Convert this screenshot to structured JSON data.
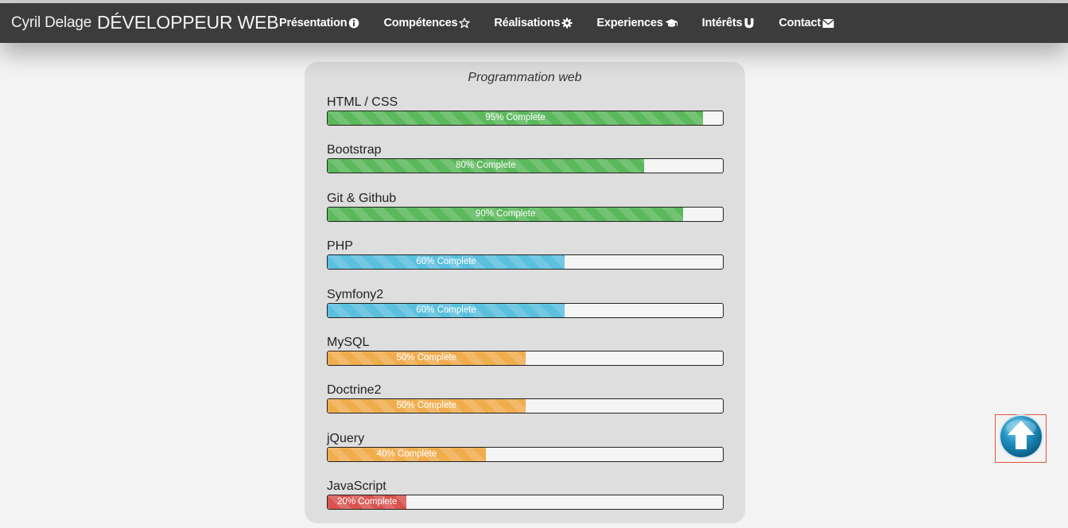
{
  "header": {
    "name": "Cyril Delage",
    "title": "DÉVELOPPEUR WEB",
    "nav": [
      {
        "label": "Présentation",
        "icon": "info-circle-icon"
      },
      {
        "label": "Compétences",
        "icon": "star-icon"
      },
      {
        "label": "Réalisations",
        "icon": "gear-icon"
      },
      {
        "label": "Experiences",
        "icon": "graduation-cap-icon"
      },
      {
        "label": "Intérêts",
        "icon": "magnet-icon"
      },
      {
        "label": "Contact",
        "icon": "envelope-icon"
      }
    ]
  },
  "panel": {
    "title": "Programmation web",
    "skills": [
      {
        "name": "HTML / CSS",
        "percent": 95,
        "label": "95% Complete",
        "color": "#5cb85c"
      },
      {
        "name": "Bootstrap",
        "percent": 80,
        "label": "80% Complete",
        "color": "#5cb85c"
      },
      {
        "name": "Git & Github",
        "percent": 90,
        "label": "90% Complete",
        "color": "#5cb85c"
      },
      {
        "name": "PHP",
        "percent": 60,
        "label": "60% Complete",
        "color": "#5bc0de"
      },
      {
        "name": "Symfony2",
        "percent": 60,
        "label": "60% Complete",
        "color": "#5bc0de"
      },
      {
        "name": "MySQL",
        "percent": 50,
        "label": "50% Complete",
        "color": "#f0ad4e"
      },
      {
        "name": "Doctrine2",
        "percent": 50,
        "label": "50% Complete",
        "color": "#f0ad4e"
      },
      {
        "name": "jQuery",
        "percent": 40,
        "label": "40% Complete",
        "color": "#f0ad4e"
      },
      {
        "name": "JavaScript",
        "percent": 20,
        "label": "20% Complete",
        "color": "#d9534f"
      }
    ]
  },
  "scroll_top": {
    "icon": "arrow-up-circle-icon"
  }
}
